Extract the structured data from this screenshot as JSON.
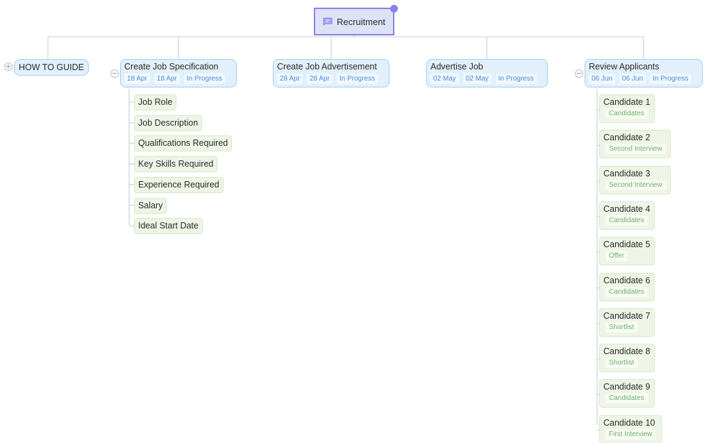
{
  "root": {
    "title": "Recruitment",
    "icon": "chat-bubble-icon"
  },
  "guide": {
    "label": "HOW TO GUIDE",
    "toggle": "+"
  },
  "stages": [
    {
      "title": "Create Job Specification",
      "start": "18 Apr",
      "end": "18 Apr",
      "status": "In Progress",
      "toggle": "−"
    },
    {
      "title": "Create Job Advertisement",
      "start": "28 Apr",
      "end": "28 Apr",
      "status": "In Progress"
    },
    {
      "title": "Advertise Job",
      "start": "02 May",
      "end": "02 May",
      "status": "In Progress"
    },
    {
      "title": "Review Applicants",
      "start": "06 Jun",
      "end": "06 Jun",
      "status": "In Progress",
      "toggle": "−"
    }
  ],
  "spec_items": [
    "Job Role",
    "Job Description",
    "Qualifications Required",
    "Key Skills Required",
    "Experience Required",
    "Salary",
    "Ideal Start Date"
  ],
  "candidates": [
    {
      "name": "Candidate 1",
      "status": "Candidates"
    },
    {
      "name": "Candidate 2",
      "status": "Second Interview"
    },
    {
      "name": "Candidate 3",
      "status": "Second Interview"
    },
    {
      "name": "Candidate 4",
      "status": "Candidates"
    },
    {
      "name": "Candidate 5",
      "status": "Offer"
    },
    {
      "name": "Candidate 6",
      "status": "Candidates"
    },
    {
      "name": "Candidate 7",
      "status": "Shortlist"
    },
    {
      "name": "Candidate 8",
      "status": "Shortlist"
    },
    {
      "name": "Candidate 9",
      "status": "Candidates"
    },
    {
      "name": "Candidate 10",
      "status": "First Interview"
    }
  ],
  "colors": {
    "root_fill": "#dde3f7",
    "root_border": "#8a80e8",
    "stage_fill": "#e2f0fb",
    "stage_border": "#9fd0f3",
    "stage_chip_text": "#4a8fd6",
    "leaf_fill": "#eef5e6",
    "leaf_border": "#d8e8c8",
    "candidate_status_text": "#6db26a",
    "connector": "#cfd6dd"
  }
}
